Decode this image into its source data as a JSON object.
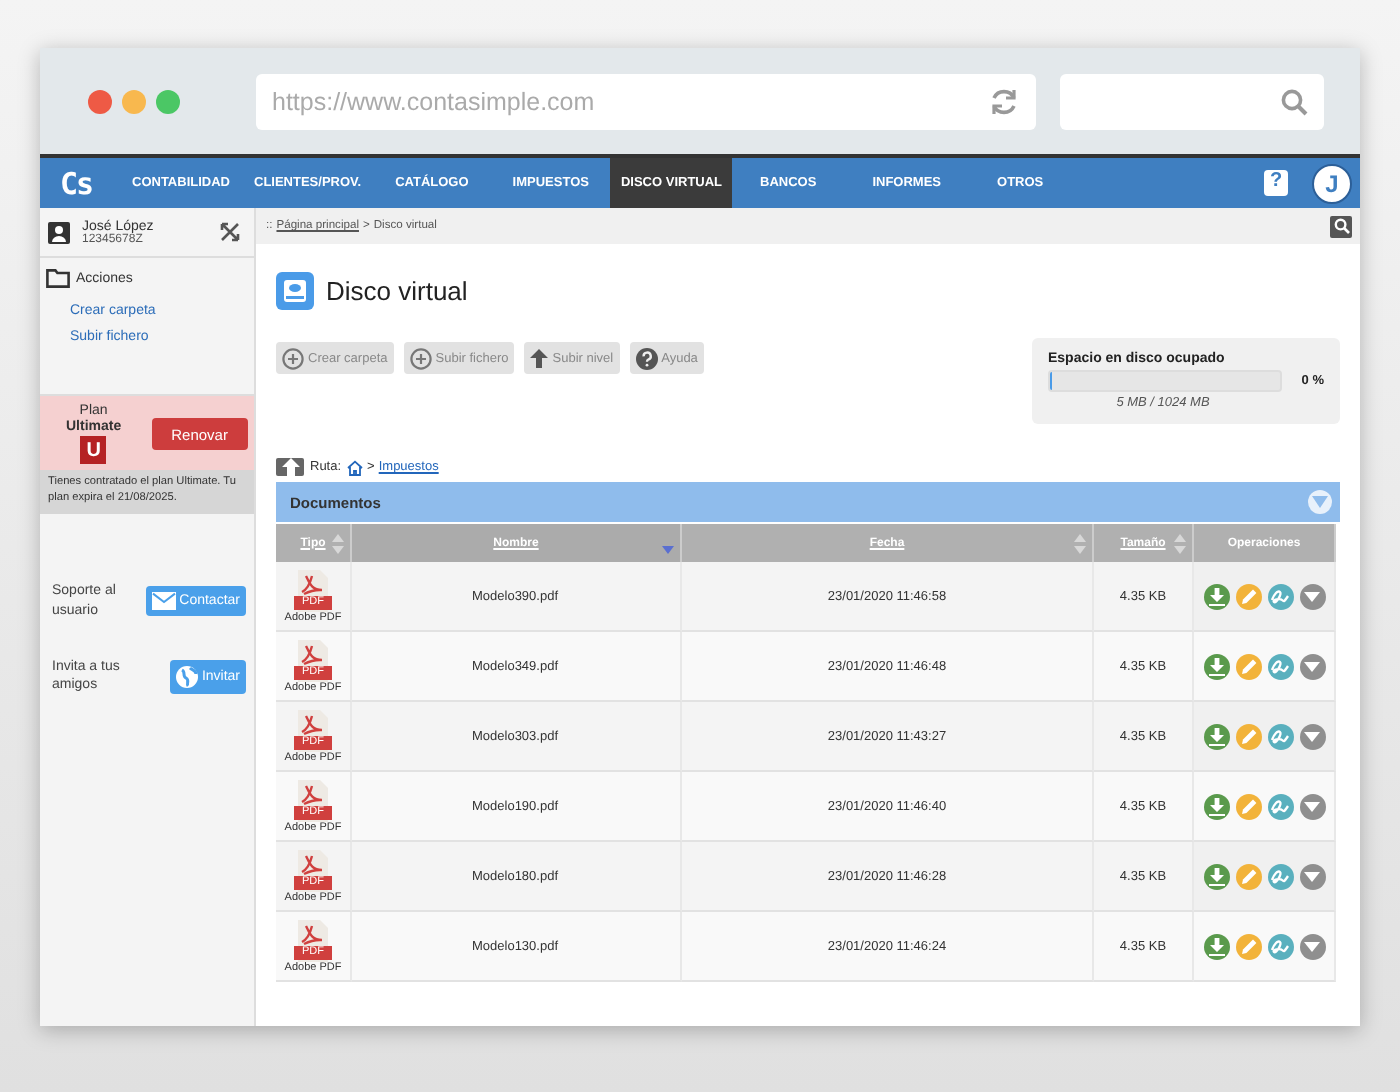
{
  "browser": {
    "url": "https://www.contasimple.com"
  },
  "nav": {
    "logo": "Cs",
    "items": [
      {
        "label": "CONTABILIDAD",
        "selected": false
      },
      {
        "label": "CLIENTES/PROV.",
        "selected": false
      },
      {
        "label": "CATÁLOGO",
        "selected": false
      },
      {
        "label": "IMPUESTOS",
        "selected": false
      },
      {
        "label": "DISCO VIRTUAL",
        "selected": true
      },
      {
        "label": "BANCOS",
        "selected": false
      },
      {
        "label": "INFORMES",
        "selected": false
      },
      {
        "label": "OTROS",
        "selected": false
      }
    ],
    "help": "?",
    "avatar": "J"
  },
  "sidebar": {
    "user_name": "José López",
    "user_id": "12345678Z",
    "actions_title": "Acciones",
    "actions": [
      "Crear carpeta",
      "Subir fichero"
    ],
    "plan": {
      "label": "Plan",
      "name": "Ultimate",
      "badge": "U",
      "button": "Renovar",
      "note": "Tienes contratado el plan Ultimate. Tu plan expira el 21/08/2025."
    },
    "support": {
      "text": "Soporte al usuario",
      "button": "Contactar"
    },
    "invite": {
      "text": "Invita a tus amigos",
      "button": "Invitar"
    }
  },
  "breadcrumb": {
    "prefix": "::",
    "items": [
      "Página principal",
      "Disco virtual"
    ],
    "separator": ">"
  },
  "page_title": "Disco virtual",
  "toolbar": [
    {
      "label": "Crear carpeta",
      "kind": "add"
    },
    {
      "label": "Subir fichero",
      "kind": "add"
    },
    {
      "label": "Subir nivel",
      "kind": "up"
    },
    {
      "label": "Ayuda",
      "kind": "help"
    }
  ],
  "disk": {
    "title": "Espacio en disco ocupado",
    "level": 0.005,
    "percent": "0 %",
    "usage": "5 MB / 1024 MB"
  },
  "path": {
    "label": "Ruta:",
    "separator": ">",
    "folder": "Impuestos"
  },
  "panel_title": "Documentos",
  "table": {
    "columns": [
      {
        "label": "Tipo",
        "sortable": true,
        "sorted": false
      },
      {
        "label": "Nombre",
        "sortable": true,
        "sorted": true
      },
      {
        "label": "Fecha",
        "sortable": true,
        "sorted": false
      },
      {
        "label": "Tamaño",
        "sortable": true,
        "sorted": false
      },
      {
        "label": "Operaciones",
        "sortable": false,
        "sorted": false
      }
    ],
    "rows": [
      {
        "icon_text": "PDF",
        "type": "Adobe PDF",
        "name": "Modelo390.pdf",
        "date": "23/01/2020 11:46:58",
        "size": "4.35 KB"
      },
      {
        "icon_text": "PDF",
        "type": "Adobe PDF",
        "name": "Modelo349.pdf",
        "date": "23/01/2020 11:46:48",
        "size": "4.35 KB"
      },
      {
        "icon_text": "PDF",
        "type": "Adobe PDF",
        "name": "Modelo303.pdf",
        "date": "23/01/2020 11:43:27",
        "size": "4.35 KB"
      },
      {
        "icon_text": "PDF",
        "type": "Adobe PDF",
        "name": "Modelo190.pdf",
        "date": "23/01/2020 11:46:40",
        "size": "4.35 KB"
      },
      {
        "icon_text": "PDF",
        "type": "Adobe PDF",
        "name": "Modelo180.pdf",
        "date": "23/01/2020 11:46:28",
        "size": "4.35 KB"
      },
      {
        "icon_text": "PDF",
        "type": "Adobe PDF",
        "name": "Modelo130.pdf",
        "date": "23/01/2020 11:46:24",
        "size": "4.35 KB"
      }
    ]
  }
}
